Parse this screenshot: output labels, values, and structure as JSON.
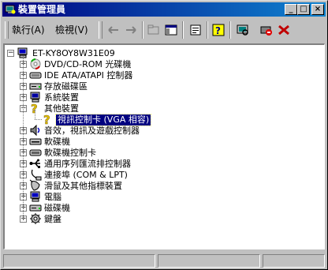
{
  "window": {
    "title": "裝置管理員",
    "caption_buttons": [
      "_",
      "□",
      "×"
    ]
  },
  "menu": {
    "action": "執行(A)",
    "view": "檢視(V)"
  },
  "toolbar_icons": [
    "back-icon",
    "forward-icon",
    "up-folder-icon",
    "show-tree-icon",
    "properties-icon",
    "help-icon",
    "scan-hardware-icon",
    "disable-device-icon",
    "uninstall-device-icon"
  ],
  "tree": {
    "root": "ET-KY8OY8W31E09",
    "categories": [
      {
        "label": "DVD/CD-ROM 光碟機",
        "icon": "dvd-drive-icon",
        "expanded": false
      },
      {
        "label": "IDE ATA/ATAPI 控制器",
        "icon": "ide-controller-icon",
        "expanded": false
      },
      {
        "label": "存放磁碟區",
        "icon": "storage-volume-icon",
        "expanded": false
      },
      {
        "label": "系統裝置",
        "icon": "system-device-icon",
        "expanded": false
      },
      {
        "label": "其他裝置",
        "icon": "unknown-device-icon",
        "expanded": true,
        "children": [
          {
            "label": "視訊控制卡 (VGA 相容)",
            "icon": "unknown-device-icon",
            "selected": true
          }
        ]
      },
      {
        "label": "音效，視訊及遊戲控制器",
        "icon": "sound-icon",
        "expanded": false
      },
      {
        "label": "軟碟機",
        "icon": "floppy-drive-icon",
        "expanded": false
      },
      {
        "label": "軟碟機控制卡",
        "icon": "floppy-controller-icon",
        "expanded": false
      },
      {
        "label": "通用序列匯流排控制器",
        "icon": "usb-icon",
        "expanded": false
      },
      {
        "label": "連接埠 (COM & LPT)",
        "icon": "port-icon",
        "expanded": false
      },
      {
        "label": "滑鼠及其他指標裝置",
        "icon": "mouse-icon",
        "expanded": false
      },
      {
        "label": "電腦",
        "icon": "computer-icon",
        "expanded": false
      },
      {
        "label": "磁碟機",
        "icon": "disk-drive-icon",
        "expanded": false
      },
      {
        "label": "鍵盤",
        "icon": "keyboard-icon",
        "expanded": false
      }
    ]
  },
  "colors": {
    "title_start": "#000080",
    "title_end": "#1084d0",
    "selection": "#000080",
    "face": "#c0c0c0"
  }
}
